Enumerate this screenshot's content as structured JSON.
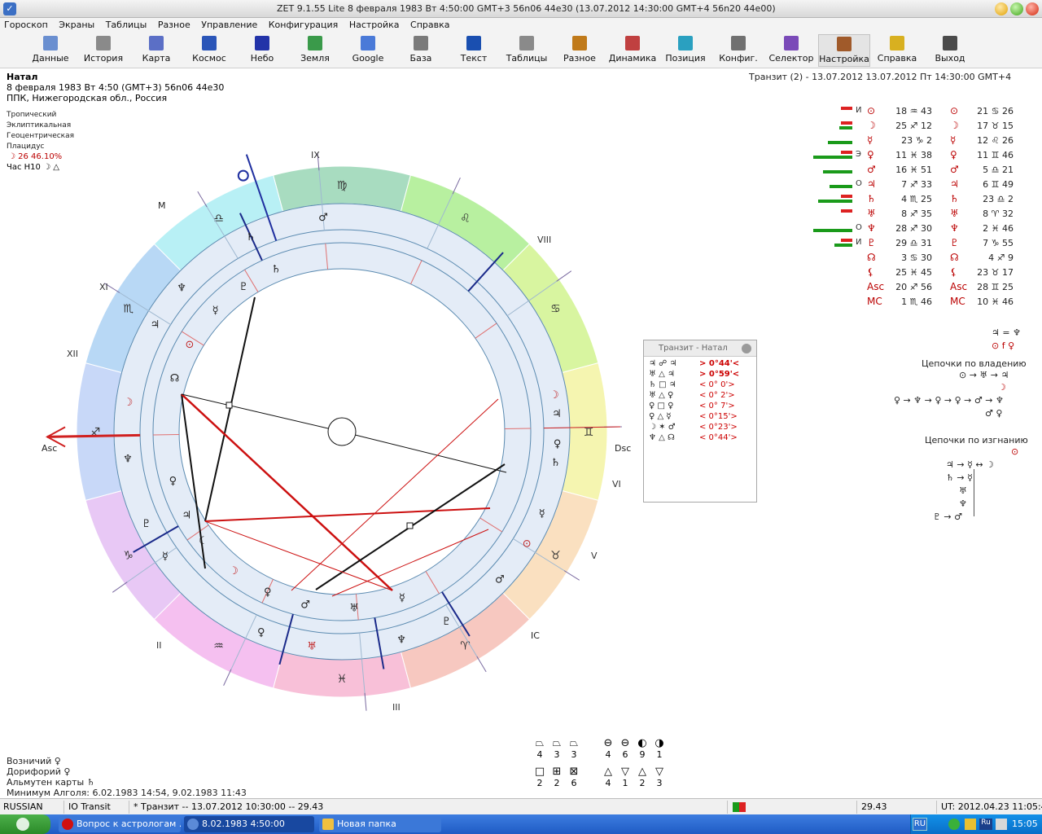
{
  "window": {
    "title": "ZET 9.1.55 Lite    8 февраля 1983  Вт    4:50:00 GMT+3 56n06  44e30  (13.07.2012  14:30:00 GMT+4 56n20 44e00)"
  },
  "menu": [
    "Гороскоп",
    "Экраны",
    "Таблицы",
    "Разное",
    "Управление",
    "Конфигурация",
    "Настройка",
    "Справка"
  ],
  "toolbar": [
    {
      "label": "Данные",
      "color": "#6a8fd0"
    },
    {
      "label": "История",
      "color": "#8a8a8a"
    },
    {
      "label": "Карта",
      "color": "#5b6fc6"
    },
    {
      "label": "Космос",
      "color": "#2a55b8"
    },
    {
      "label": "Небо",
      "color": "#2233a8"
    },
    {
      "label": "Земля",
      "color": "#3a9a4a"
    },
    {
      "label": "Google",
      "color": "#4a7ad8"
    },
    {
      "label": "База",
      "color": "#7a7a7a"
    },
    {
      "label": "Текст",
      "color": "#1a4fb0"
    },
    {
      "label": "Таблицы",
      "color": "#8a8a8a"
    },
    {
      "label": "Разное",
      "color": "#c07a1a"
    },
    {
      "label": "Динамика",
      "color": "#c04040"
    },
    {
      "label": "Позиция",
      "color": "#2aa0c0"
    },
    {
      "label": "Конфиг.",
      "color": "#707070"
    },
    {
      "label": "Селектор",
      "color": "#7a4ab8"
    },
    {
      "label": "Настройка",
      "color": "#a05a2a"
    },
    {
      "label": "Справка",
      "color": "#d8b020"
    },
    {
      "label": "Выход",
      "color": "#4a4a4a"
    }
  ],
  "natal": {
    "heading": "Натал",
    "date": "8 февраля 1983  Вт   4:50 (GMT+3) 56n06  44e30",
    "place": "ППК, Нижегородская обл., Россия",
    "zodiac": "Тропический",
    "coords": "Эклиптикальная",
    "center": "Геоцентрическая",
    "houses": "Плацидус",
    "moon_phase": "☽   26 46.10%",
    "hour_ruler": "Час H10  ☽  △"
  },
  "transit": {
    "heading": "Транзит (2) - 13.07.2012 13.07.2012  Пт 14:30:00 GMT+4"
  },
  "chart": {
    "angle_labels": {
      "asc": "Asc",
      "dsc": "Dsc",
      "ic": "IC",
      "mc": "M"
    },
    "house_labels": [
      "IX",
      "VIII",
      "XI",
      "XII",
      "VI",
      "V",
      "II",
      "III"
    ],
    "zodiac_glyphs": [
      "♍",
      "♌",
      "♋",
      "♊",
      "♉",
      "♈",
      "♓",
      "♒",
      "♑",
      "♐",
      "♏",
      "♎"
    ],
    "zodiac_colors": [
      "#a8dcc0",
      "#b8f0a0",
      "#d8f5a0",
      "#f5f5b0",
      "#fae0c0",
      "#f7c8c0",
      "#f8c0d8",
      "#f5c0f0",
      "#e8c8f5",
      "#c8d8f8",
      "#b8d8f5",
      "#b8f0f5"
    ],
    "transit_glyphs": [
      "♂",
      "♄",
      "♆",
      "♃",
      "☽",
      "♆",
      "♇",
      "☿",
      "♀",
      "♅",
      "♆",
      "♇",
      "♂",
      "⊙",
      "☿",
      "♄",
      "♀",
      "♃",
      "☽"
    ],
    "natal_glyphs": [
      "♄",
      "♇",
      "☿",
      "⊙",
      "☊",
      "♀",
      "♃",
      "☾",
      "☽",
      "♀",
      "♂",
      "♅",
      "☿"
    ]
  },
  "planets": [
    {
      "tag": "И",
      "g1": "⊙",
      "v1": "18 ♒ 43",
      "g2": "⊙",
      "v2": "21 ♋ 26",
      "red": 14,
      "grn": 0
    },
    {
      "tag": "",
      "g1": "☽",
      "v1": "25 ♐ 12",
      "g2": "☽",
      "v2": "17 ♉ 15",
      "red": 14,
      "grn": 16
    },
    {
      "tag": "",
      "g1": "☿",
      "v1": "23 ♑ 2",
      "g2": "☿",
      "v2": "12 ♌ 26",
      "red": 0,
      "grn": 30
    },
    {
      "tag": "Э",
      "g1": "♀",
      "v1": "11 ♓ 38",
      "g2": "♀",
      "v2": "11 ♊ 46",
      "red": 14,
      "grn": 48
    },
    {
      "tag": "",
      "g1": "♂",
      "v1": "16 ♓ 51",
      "g2": "♂",
      "v2": "5 ♎ 21",
      "red": 0,
      "grn": 36
    },
    {
      "tag": "О",
      "g1": "♃",
      "v1": "7 ♐ 33",
      "g2": "♃",
      "v2": "6 ♊ 49",
      "red": 0,
      "grn": 28
    },
    {
      "tag": "",
      "g1": "♄",
      "v1": "4 ♏ 25",
      "g2": "♄",
      "v2": "23 ♎ 2",
      "red": 14,
      "grn": 42
    },
    {
      "tag": "",
      "g1": "♅",
      "v1": "8 ♐ 35",
      "g2": "♅",
      "v2": "8 ♈ 32",
      "red": 14,
      "grn": 0
    },
    {
      "tag": "О",
      "g1": "♆",
      "v1": "28 ♐ 30",
      "g2": "♆",
      "v2": "2 ♓ 46",
      "red": 0,
      "grn": 48
    },
    {
      "tag": "И",
      "g1": "♇",
      "v1": "29 ♎ 31",
      "g2": "♇",
      "v2": "7 ♑ 55",
      "red": 14,
      "grn": 22
    },
    {
      "tag": "",
      "g1": "☊",
      "v1": "3 ♋ 30",
      "g2": "☊",
      "v2": "4 ♐ 9",
      "red": 0,
      "grn": 0
    },
    {
      "tag": "",
      "g1": "⚸",
      "v1": "25 ♓ 45",
      "g2": "⚸",
      "v2": "23 ♉ 17",
      "red": 0,
      "grn": 0
    },
    {
      "tag": "",
      "g1": "Asc",
      "v1": "20 ♐ 56",
      "g2": "Asc",
      "v2": "28 ♊ 25",
      "red": 0,
      "grn": 0
    },
    {
      "tag": "",
      "g1": "MC",
      "v1": "1 ♏ 46",
      "g2": "MC",
      "v2": "10 ♓ 46",
      "red": 0,
      "grn": 0
    }
  ],
  "aspects_panel": {
    "title": "Транзит - Натал",
    "rows": [
      {
        "p": "♃  ☍  ♃",
        "orb": ">  0°44'<",
        "bold": true
      },
      {
        "p": "♅  △  ♃",
        "orb": ">  0°59'<",
        "bold": true
      },
      {
        "p": "♄  □  ♃",
        "orb": "<  0° 0'>",
        "bold": false
      },
      {
        "p": "♅  △  ♀",
        "orb": "<  0° 2'>",
        "bold": false
      },
      {
        "p": "♀  □  ♀",
        "orb": "<  0° 7'>",
        "bold": false
      },
      {
        "p": "♀  △  ☿",
        "orb": "<  0°15'>",
        "bold": false
      },
      {
        "p": "☽  ✶  ♂",
        "orb": "<  0°23'>",
        "bold": false
      },
      {
        "p": "♆  △  ☊",
        "orb": "<  0°44'>",
        "bold": false
      }
    ]
  },
  "chains": {
    "reception": "♃ = ♆",
    "reception2": "⊙ f ♀",
    "rulership_title": "Цепочки по владению",
    "rul_1": "⊙ → ♅ → ♃",
    "rul_2": "☽",
    "rul_3": "♀ → ♆ → ♀ → ♀ → ♂ → ♆",
    "rul_4": "♂ ♀",
    "exile_title": "Цепочки по изгнанию",
    "ex_0": "⊙",
    "ex_1": "♃ → ☿ ↔ ☽",
    "ex_2": "♄ → ☿",
    "ex_3": "♅",
    "ex_4": "♆",
    "ex_5": "♇ → ♂"
  },
  "bottom_info": {
    "voznichiy": "Возничий  ♀",
    "dorifory": "Дорифорий  ♀",
    "almuten": "Альмутен карты  ♄",
    "algol": "Минимум Алголя: 6.02.1983 14:54,  9.02.1983 11:43"
  },
  "elements": [
    {
      "sym": "⏢",
      "n": "4"
    },
    {
      "sym": "⏢",
      "n": "3"
    },
    {
      "sym": "⏢",
      "n": "3"
    },
    {
      "sym": "⊖",
      "n": "4"
    },
    {
      "sym": "⊖",
      "n": "6"
    },
    {
      "sym": "◐",
      "n": "9"
    },
    {
      "sym": "◑",
      "n": "1"
    },
    {
      "sym": "□",
      "n": "2"
    },
    {
      "sym": "⊞",
      "n": "2"
    },
    {
      "sym": "⊠",
      "n": "6"
    },
    {
      "sym": "△",
      "n": "4"
    },
    {
      "sym": "▽",
      "n": "1"
    },
    {
      "sym": "△",
      "n": "2"
    },
    {
      "sym": "▽",
      "n": "3"
    }
  ],
  "status": {
    "lang": "RUSSIAN",
    "mode": "IO Transit",
    "transit": "*  Транзит -- 13.07.2012 10:30:00 -- 29.43",
    "value": "29.43",
    "ut": "UT: 2012.04.23 11:05:45"
  },
  "taskbar": {
    "task1": "Вопрос к астрологам ...",
    "task2": "8.02.1983   4:50:00",
    "task3": "Новая папка",
    "lang": "RU",
    "clock": "15:05"
  }
}
